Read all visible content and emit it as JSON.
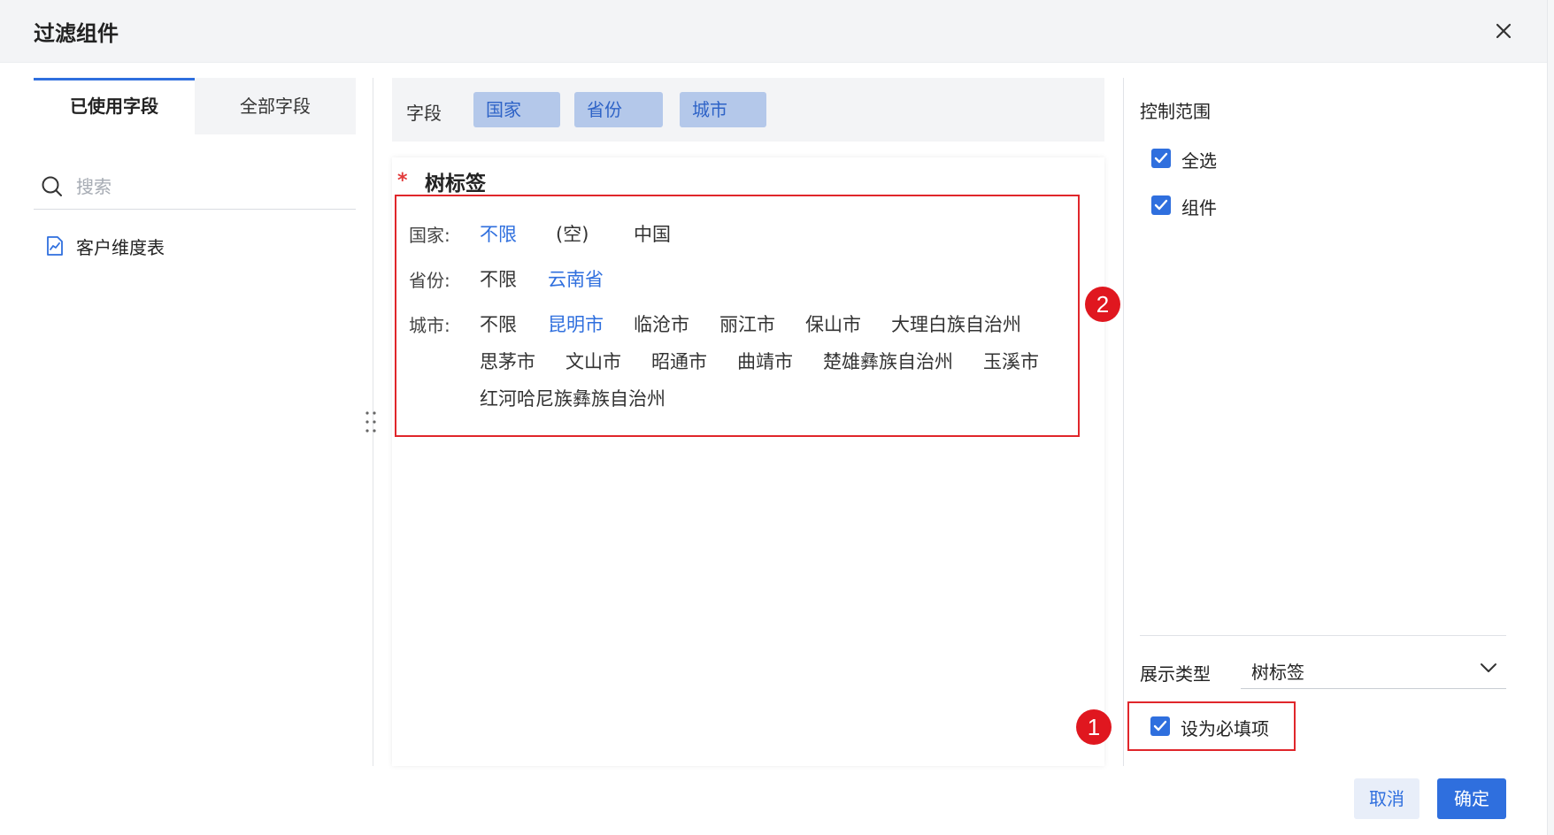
{
  "dialog": {
    "title": "过滤组件"
  },
  "left_panel": {
    "tabs": [
      {
        "label": "已使用字段",
        "active": true
      },
      {
        "label": "全部字段",
        "active": false
      }
    ],
    "search": {
      "placeholder": "搜索",
      "value": ""
    },
    "tables": [
      {
        "label": "客户维度表",
        "icon": "chart-table-icon"
      }
    ]
  },
  "field_bar": {
    "label": "字段",
    "chips": [
      "国家",
      "省份",
      "城市"
    ]
  },
  "preview": {
    "title": "树标签",
    "required_mark": "*",
    "rows": [
      {
        "label": "国家:",
        "options": [
          {
            "text": "不限",
            "selected": true
          },
          {
            "text": "(空)",
            "selected": false
          },
          {
            "text": "中国",
            "selected": false
          }
        ]
      },
      {
        "label": "省份:",
        "options": [
          {
            "text": "不限",
            "selected": false
          },
          {
            "text": "云南省",
            "selected": true
          }
        ]
      },
      {
        "label": "城市:",
        "options": [
          {
            "text": "不限",
            "selected": false
          },
          {
            "text": "昆明市",
            "selected": true
          },
          {
            "text": "临沧市",
            "selected": false
          },
          {
            "text": "丽江市",
            "selected": false
          },
          {
            "text": "保山市",
            "selected": false
          },
          {
            "text": "大理白族自治州",
            "selected": false
          },
          {
            "text": "思茅市",
            "selected": false
          },
          {
            "text": "文山市",
            "selected": false
          },
          {
            "text": "昭通市",
            "selected": false
          },
          {
            "text": "曲靖市",
            "selected": false
          },
          {
            "text": "楚雄彝族自治州",
            "selected": false
          },
          {
            "text": "玉溪市",
            "selected": false
          },
          {
            "text": "红河哈尼族彝族自治州",
            "selected": false
          }
        ]
      }
    ]
  },
  "right_panel": {
    "scope_title": "控制范围",
    "scope_options": [
      {
        "label": "全选",
        "checked": true
      },
      {
        "label": "组件",
        "checked": true
      }
    ],
    "display_type_label": "展示类型",
    "display_type_value": "树标签",
    "required_checkbox": {
      "label": "设为必填项",
      "checked": true
    }
  },
  "annotations": {
    "badge_1": "1",
    "badge_2": "2"
  },
  "footer": {
    "cancel_label": "取消",
    "ok_label": "确定"
  },
  "colors": {
    "accent": "#2f6fde",
    "chip_bg": "#b4c8ea",
    "annotation_red": "#e0262b"
  }
}
